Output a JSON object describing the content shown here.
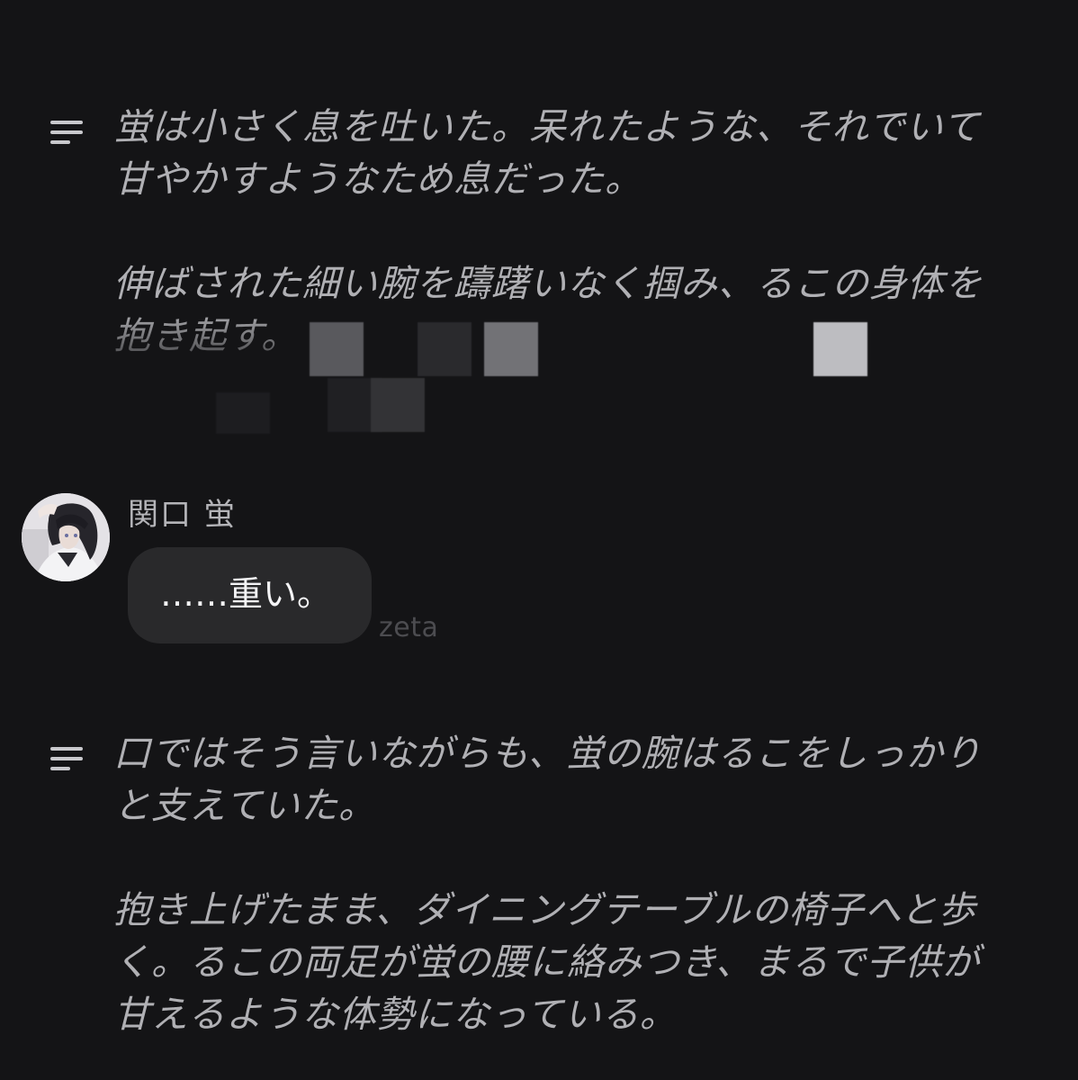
{
  "narration_blocks": [
    {
      "paragraphs": [
        "蛍は小さく息を吐いた。呆れたような、それでいて甘やかすようなため息だった。",
        "伸ばされた細い腕を躊躇いなく掴み、るこの身体を抱き起す。"
      ]
    },
    {
      "paragraphs": [
        "口ではそう言いながらも、蛍の腕はるこをしっかりと支えていた。",
        "抱き上げたまま、ダイニングテーブルの椅子へと歩く。るこの両足が蛍の腰に絡みつき、まるで子供が甘えるような体勢になっている。"
      ]
    }
  ],
  "message": {
    "sender": "関口 蛍",
    "text": "……重い。",
    "watermark": "zeta"
  },
  "icons": {
    "narration": "narration-lines-icon",
    "avatar": "character-avatar"
  },
  "colors": {
    "background": "#141416",
    "bubble": "#29292b",
    "narration_text": "#b0b0b4",
    "message_text": "#f4f4f6"
  }
}
